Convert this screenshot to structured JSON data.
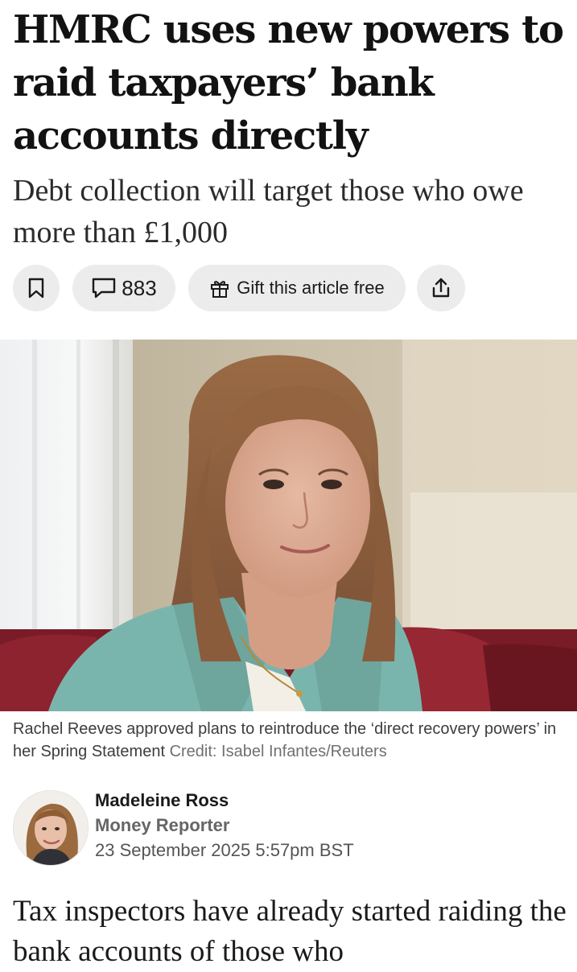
{
  "article": {
    "headline": "HMRC uses new powers to raid taxpayers’ bank accounts directly",
    "standfirst": "Debt collection will target those who owe more than £1,000"
  },
  "actions": {
    "bookmark_icon": "bookmark-icon",
    "comment_icon": "speech-bubble-icon",
    "comment_count": "883",
    "gift_icon": "gift-icon",
    "gift_label": "Gift this article free",
    "share_icon": "share-upload-icon"
  },
  "image": {
    "caption": "Rachel Reeves approved plans to reintroduce the ‘direct recovery powers’ in her Spring Statement",
    "credit": "Credit: Isabel Infantes/Reuters"
  },
  "author": {
    "name": "Madeleine Ross",
    "role": "Money Reporter",
    "date": "23 September 2025 5:57pm BST"
  },
  "body": {
    "first_paragraph": "Tax inspectors have already started raiding the bank accounts of those who"
  },
  "colors": {
    "text": "#121212",
    "pill_background": "#ececec",
    "caption": "#3d3d3d",
    "credit": "#707070",
    "jacket": "#7ab5ad",
    "chair": "#8e2330"
  }
}
